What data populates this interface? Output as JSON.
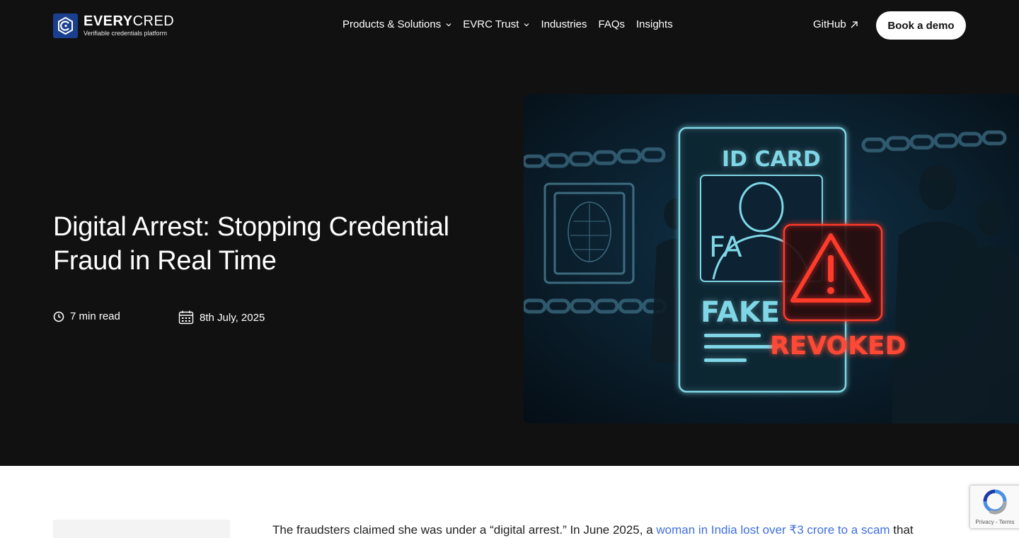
{
  "brand": {
    "name_bold": "EVERY",
    "name_light": "CRED",
    "tagline": "Verifiable credentials platform",
    "color": "#1b3f8f"
  },
  "nav": {
    "items": [
      {
        "label": "Products & Solutions",
        "dropdown": true
      },
      {
        "label": "EVRC Trust",
        "dropdown": true
      },
      {
        "label": "Industries",
        "dropdown": false
      },
      {
        "label": "FAQs",
        "dropdown": false
      },
      {
        "label": "Insights",
        "dropdown": false
      }
    ],
    "github_label": "GitHub",
    "demo_label": "Book a demo"
  },
  "hero": {
    "title": "Digital Arrest: Stopping Credential Fraud in Real Time",
    "read_time": "7 min read",
    "date": "8th July, 2025",
    "image": {
      "card_title": "ID CARD",
      "card_partial": "FA",
      "fake_label": "FAKE",
      "revoked_label": "REVOKED"
    }
  },
  "article": {
    "lead_before": "The fraudsters claimed she was under a “digital arrest.” In June 2025, a ",
    "lead_link": "woman in India lost over ₹3 crore to a scam",
    "lead_after": " that"
  },
  "recaptcha": {
    "text": "Privacy - Terms"
  },
  "colors": {
    "background": "#111111",
    "link": "#3f6fe0",
    "alert": "#ff3a2a",
    "card_cyan": "#7fd6e6"
  }
}
